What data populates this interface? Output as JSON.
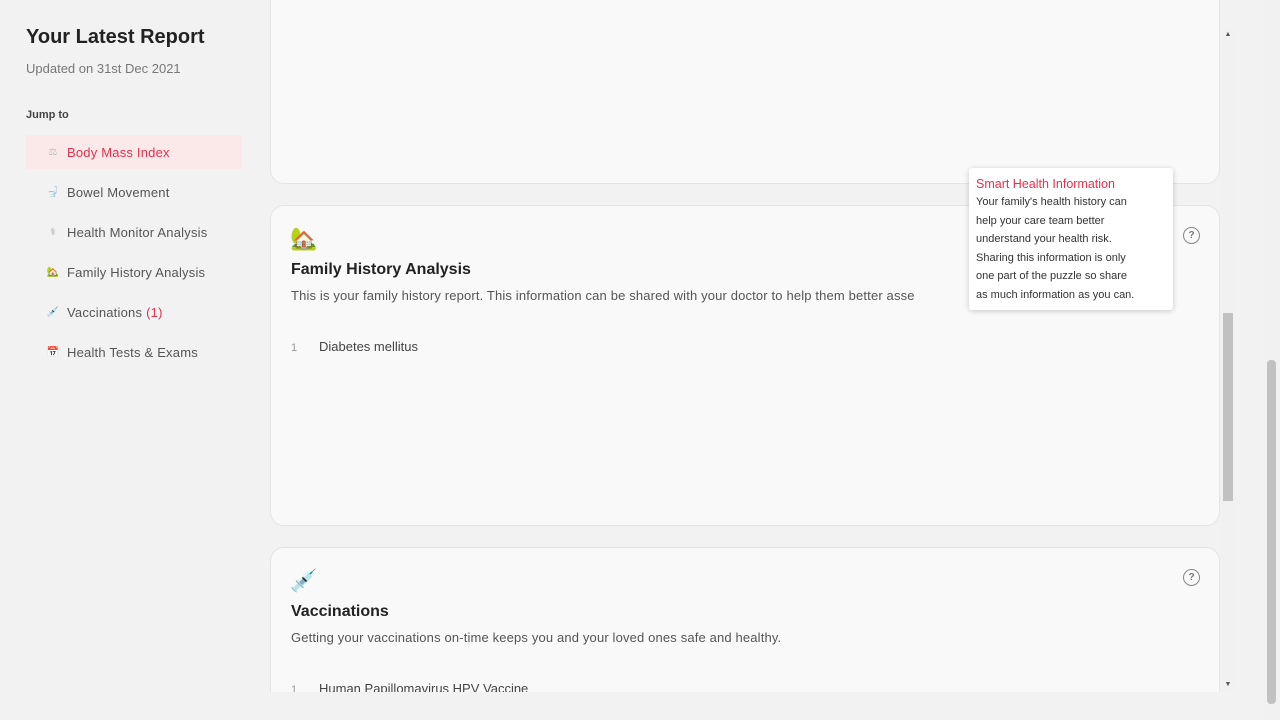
{
  "sidebar": {
    "title": "Your Latest Report",
    "updated": "Updated on 31st Dec 2021",
    "jump_label": "Jump to",
    "items": [
      {
        "icon": "⚖",
        "label": "Body Mass Index",
        "count": ""
      },
      {
        "icon": "🚽",
        "label": "Bowel Movement",
        "count": ""
      },
      {
        "icon": "⚕",
        "label": "Health Monitor Analysis",
        "count": ""
      },
      {
        "icon": "🏡",
        "label": "Family History Analysis",
        "count": ""
      },
      {
        "icon": "💉",
        "label": "Vaccinations",
        "count": "(1)"
      },
      {
        "icon": "📅",
        "label": "Health Tests & Exams",
        "count": ""
      }
    ]
  },
  "family": {
    "emoji": "🏡",
    "title": "Family History Analysis",
    "description": "This is your family history report. This information can be shared with your doctor to help them better asse",
    "items": [
      {
        "num": "1",
        "label": "Diabetes mellitus"
      }
    ]
  },
  "vaccinations": {
    "emoji": "💉",
    "title": "Vaccinations",
    "description": "Getting your vaccinations on-time keeps you and your loved ones safe and healthy.",
    "items": [
      {
        "num": "1",
        "label": "Human Papillomavirus HPV Vaccine"
      }
    ]
  },
  "help_glyph": "?",
  "tooltip": {
    "title": "Smart Health Information",
    "lines": [
      "Your family's health history can",
      "help your care team better",
      "understand your health risk.",
      "Sharing this information is only",
      "one part of the puzzle so share",
      "as much information as you can."
    ]
  },
  "scrollbar": {
    "up_arrow": "▲",
    "down_arrow": "▼"
  },
  "colors": {
    "accent": "#e0334f",
    "active_bg": "#fbe9e9",
    "page_bg": "#f2f2f2"
  }
}
